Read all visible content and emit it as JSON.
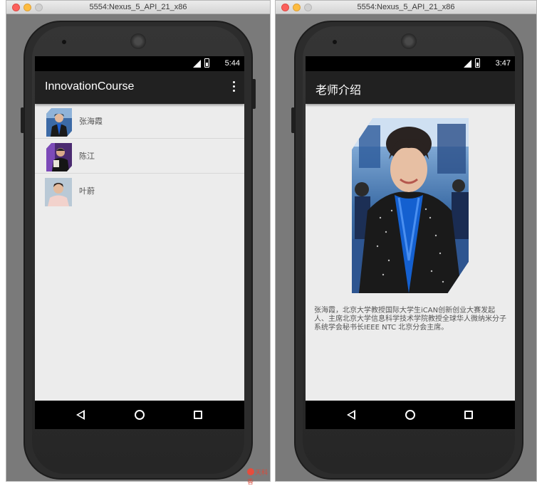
{
  "emulator": {
    "window_title": "5554:Nexus_5_API_21_x86"
  },
  "screen_list": {
    "status_time": "5:44",
    "app_title": "InnovationCourse",
    "teachers": [
      {
        "name": "张海霞"
      },
      {
        "name": "陈江"
      },
      {
        "name": "叶蔚"
      }
    ]
  },
  "screen_detail": {
    "status_time": "3:47",
    "app_title": "老师介绍",
    "bio": "张海霞，北京大学教授国际大学生iCAN创新创业大赛发起人、主席北京大学信息科学技术学院教授全球华人微纳米分子系统学会秘书长IEEE NTC 北京分会主席。"
  },
  "watermark": "天科香",
  "colors": {
    "appbar": "#212121",
    "statusbar": "#000000",
    "screen_bg": "#ececec",
    "desktop_bg": "#7a7a7a"
  }
}
